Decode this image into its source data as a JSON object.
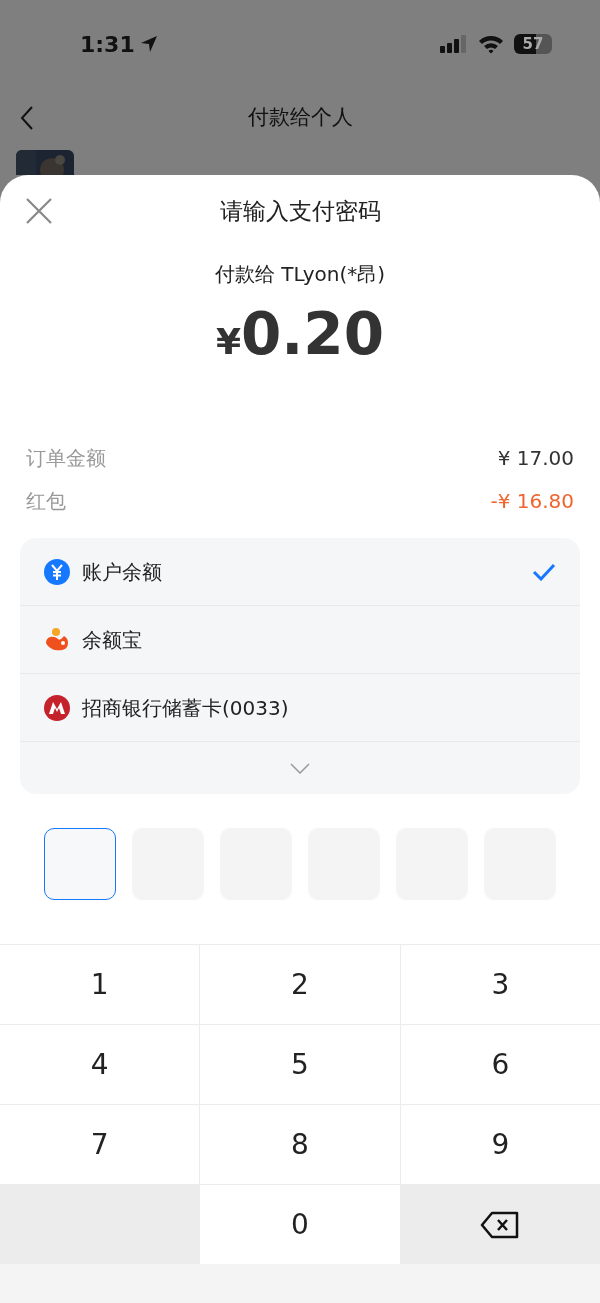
{
  "status_bar": {
    "time": "1:31",
    "battery": "57"
  },
  "background_page": {
    "title": "付款给个人"
  },
  "sheet": {
    "title": "请输入支付密码",
    "payee": "付款给 TLyon(*昂)",
    "amount_symbol": "¥",
    "amount": "0.20"
  },
  "summary": [
    {
      "label": "订单金额",
      "value": "¥ 17.00",
      "kind": "normal"
    },
    {
      "label": "红包",
      "value": "-¥ 16.80",
      "kind": "discount"
    }
  ],
  "payment_methods": [
    {
      "label": "账户余额",
      "kind": "balance",
      "selected": true
    },
    {
      "label": "余额宝",
      "kind": "yuebao",
      "selected": false
    },
    {
      "label": "招商银行储蓄卡(0033)",
      "kind": "bank",
      "selected": false
    }
  ],
  "pin_boxes": [
    {
      "selected": true
    },
    {
      "selected": false
    },
    {
      "selected": false
    },
    {
      "selected": false
    },
    {
      "selected": false
    },
    {
      "selected": false
    }
  ],
  "keypad": [
    {
      "label": "1",
      "kind": "digit"
    },
    {
      "label": "2",
      "kind": "digit"
    },
    {
      "label": "3",
      "kind": "digit"
    },
    {
      "label": "4",
      "kind": "digit"
    },
    {
      "label": "5",
      "kind": "digit"
    },
    {
      "label": "6",
      "kind": "digit"
    },
    {
      "label": "7",
      "kind": "digit"
    },
    {
      "label": "8",
      "kind": "digit"
    },
    {
      "label": "9",
      "kind": "digit"
    },
    {
      "kind": "blank"
    },
    {
      "label": "0",
      "kind": "digit"
    },
    {
      "kind": "backspace"
    }
  ]
}
